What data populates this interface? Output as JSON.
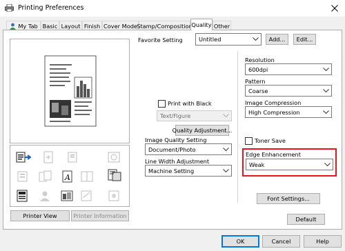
{
  "window": {
    "title": "Printing Preferences"
  },
  "tabs": [
    {
      "label": "My Tab",
      "active": false
    },
    {
      "label": "Basic",
      "active": false
    },
    {
      "label": "Layout",
      "active": false
    },
    {
      "label": "Finish",
      "active": false
    },
    {
      "label": "Cover Mode",
      "active": false
    },
    {
      "label": "Stamp/Composition",
      "active": false
    },
    {
      "label": "Quality",
      "active": true
    },
    {
      "label": "Other",
      "active": false
    }
  ],
  "favorite": {
    "label": "Favorite Setting",
    "value": "Untitled",
    "add_button": "Add...",
    "edit_button": "Edit..."
  },
  "print_with_black": {
    "label": "Print with Black",
    "checked": false,
    "select_value": "Text/Figure"
  },
  "quality_adjustment_button": "Quality Adjustment...",
  "image_quality": {
    "label": "Image Quality Setting",
    "value": "Document/Photo"
  },
  "line_width": {
    "label": "Line Width Adjustment",
    "value": "Machine Setting"
  },
  "resolution": {
    "label": "Resolution",
    "value": "600dpi"
  },
  "pattern": {
    "label": "Pattern",
    "value": "Coarse"
  },
  "image_compression": {
    "label": "Image Compression",
    "value": "High Compression"
  },
  "toner_save": {
    "label": "Toner Save",
    "checked": false
  },
  "edge_enhancement": {
    "label": "Edge Enhancement",
    "value": "Weak",
    "highlight_color": "#e8141b"
  },
  "font_settings_button": "Font Settings...",
  "default_button": "Default",
  "printer_view_button": "Printer View",
  "printer_information_button": "Printer Information",
  "dialog_buttons": {
    "ok": "OK",
    "cancel": "Cancel",
    "help": "Help"
  },
  "colors": {
    "accent": "#0078d7",
    "highlight": "#e8141b"
  }
}
